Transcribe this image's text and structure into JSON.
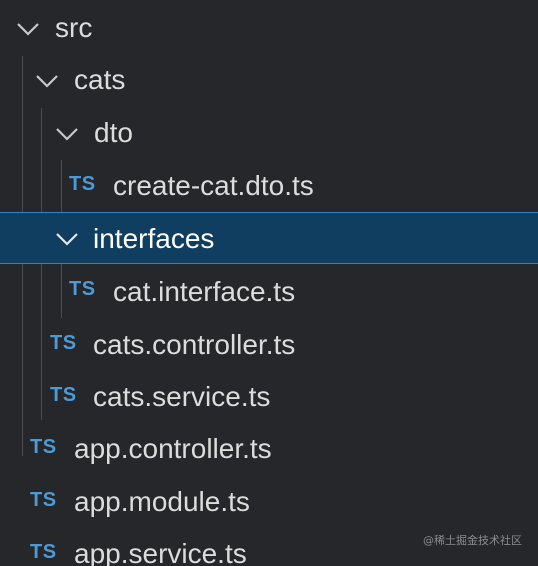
{
  "explorer": {
    "rows": [
      {
        "type": "folder",
        "label": "src",
        "expanded": true
      },
      {
        "type": "folder",
        "label": "cats",
        "expanded": true
      },
      {
        "type": "folder",
        "label": "dto",
        "expanded": true
      },
      {
        "type": "file",
        "badge": "TS",
        "label": "create-cat.dto.ts"
      },
      {
        "type": "folder",
        "label": "interfaces",
        "expanded": true,
        "selected": true
      },
      {
        "type": "file",
        "badge": "TS",
        "label": "cat.interface.ts"
      },
      {
        "type": "file",
        "badge": "TS",
        "label": "cats.controller.ts"
      },
      {
        "type": "file",
        "badge": "TS",
        "label": "cats.service.ts"
      },
      {
        "type": "file",
        "badge": "TS",
        "label": "app.controller.ts"
      },
      {
        "type": "file",
        "badge": "TS",
        "label": "app.module.ts"
      },
      {
        "type": "file",
        "badge": "TS",
        "label": "app.service.ts"
      }
    ]
  },
  "watermark": "@稀土掘金技术社区",
  "colors": {
    "background": "#25272b",
    "selection": "#0f3e61",
    "selection_border": "#2b86c9",
    "ts_badge": "#4e9ad6",
    "text": "#dcdcdc"
  },
  "icons": {
    "folder_expanded": "chevron-down-icon",
    "file_typescript": "typescript-file-icon"
  }
}
